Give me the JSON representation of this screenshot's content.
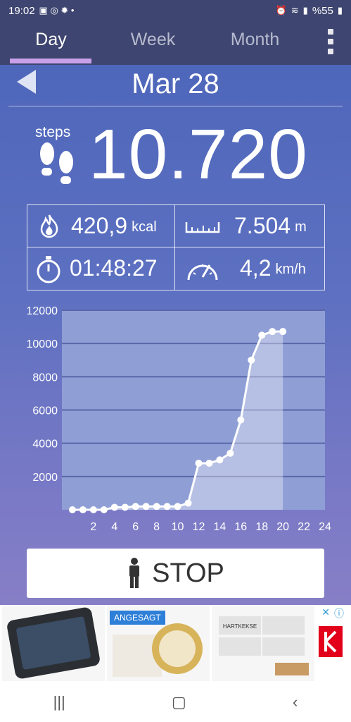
{
  "status_bar": {
    "time": "19:02",
    "battery": "%55"
  },
  "tabs": [
    {
      "label": "Day",
      "active": true
    },
    {
      "label": "Week",
      "active": false
    },
    {
      "label": "Month",
      "active": false
    }
  ],
  "date": "Mar 28",
  "steps": {
    "label": "steps",
    "value": "10.720"
  },
  "stats": {
    "calories": {
      "value": "420,9",
      "unit": "kcal"
    },
    "distance": {
      "value": "7.504",
      "unit": "m"
    },
    "duration": {
      "value": "01:48:27"
    },
    "speed": {
      "value": "4,2",
      "unit": "km/h"
    }
  },
  "chart_data": {
    "type": "area",
    "x": [
      0,
      1,
      2,
      3,
      4,
      5,
      6,
      7,
      8,
      9,
      10,
      11,
      12,
      13,
      14,
      15,
      16,
      17,
      18,
      19,
      20
    ],
    "values": [
      0,
      0,
      0,
      0,
      150,
      150,
      200,
      200,
      200,
      200,
      200,
      400,
      2800,
      2800,
      3000,
      3400,
      5400,
      9000,
      10500,
      10720,
      10720
    ],
    "x_ticks": [
      "2",
      "4",
      "6",
      "8",
      "10",
      "12",
      "14",
      "16",
      "18",
      "20",
      "22",
      "24"
    ],
    "y_ticks": [
      "2000",
      "4000",
      "6000",
      "8000",
      "10000",
      "12000"
    ],
    "xlim": [
      -1,
      24
    ],
    "ylim": [
      0,
      12000
    ],
    "grid": true
  },
  "stop_button": {
    "label": "STOP"
  },
  "ads": {
    "tag": "ANGESAGT",
    "product_text": "HARTKEKSE"
  },
  "colors": {
    "accent": "#c9a0ea",
    "header": "#3e4570"
  }
}
